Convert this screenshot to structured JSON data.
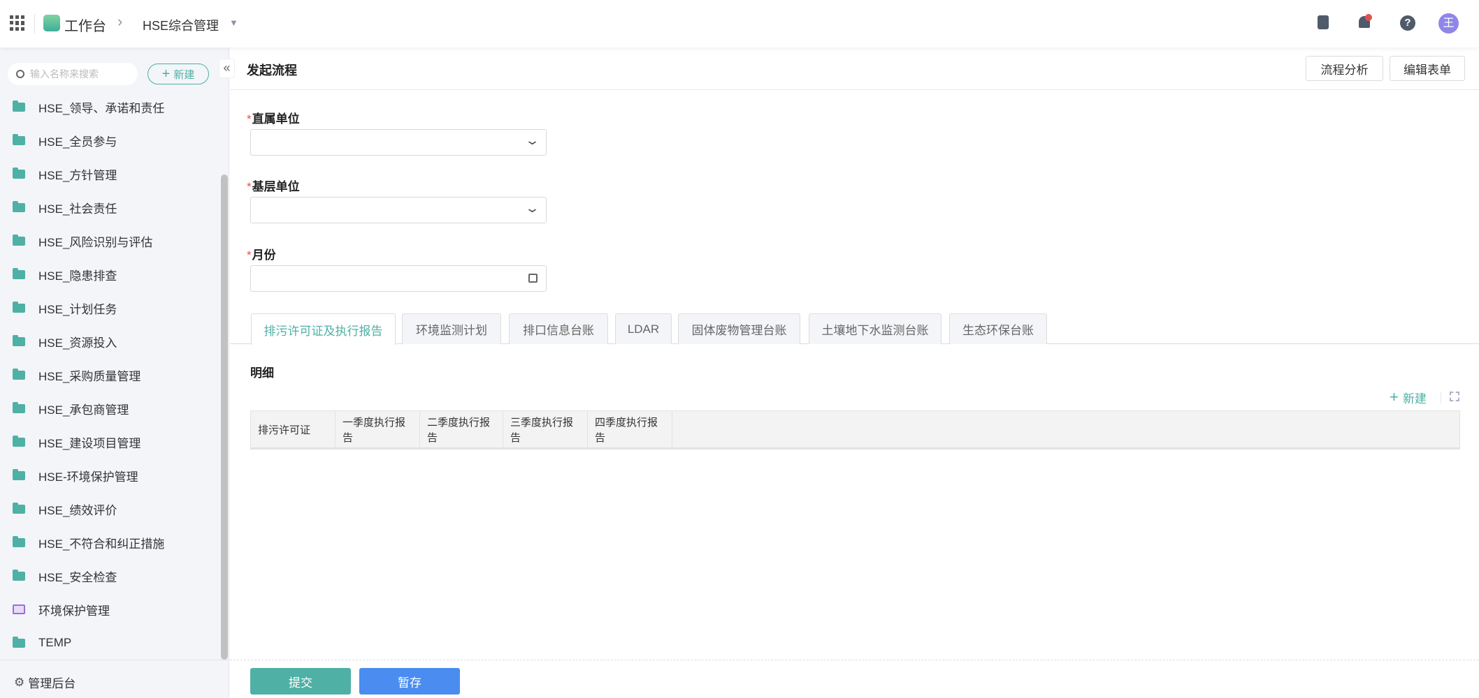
{
  "topbar": {
    "app": "工作台",
    "module": "HSE综合管理",
    "avatar": "王"
  },
  "sidebar": {
    "search_placeholder": "输入名称来搜索",
    "new_label": "新建",
    "items": [
      {
        "label": "HSE_领导、承诺和责任",
        "icon": "folder"
      },
      {
        "label": "HSE_全员参与",
        "icon": "folder"
      },
      {
        "label": "HSE_方针管理",
        "icon": "folder"
      },
      {
        "label": "HSE_社会责任",
        "icon": "folder"
      },
      {
        "label": "HSE_风险识别与评估",
        "icon": "folder"
      },
      {
        "label": "HSE_隐患排查",
        "icon": "folder"
      },
      {
        "label": "HSE_计划任务",
        "icon": "folder"
      },
      {
        "label": "HSE_资源投入",
        "icon": "folder"
      },
      {
        "label": "HSE_采购质量管理",
        "icon": "folder"
      },
      {
        "label": "HSE_承包商管理",
        "icon": "folder"
      },
      {
        "label": "HSE_建设项目管理",
        "icon": "folder"
      },
      {
        "label": "HSE-环境保护管理",
        "icon": "folder"
      },
      {
        "label": "HSE_绩效评价",
        "icon": "folder"
      },
      {
        "label": "HSE_不符合和纠正措施",
        "icon": "folder"
      },
      {
        "label": "HSE_安全检查",
        "icon": "folder"
      },
      {
        "label": "环境保护管理",
        "icon": "monitor"
      },
      {
        "label": "TEMP",
        "icon": "folder"
      }
    ],
    "admin": "管理后台"
  },
  "main": {
    "title": "发起流程",
    "flow_analysis": "流程分析",
    "edit_form": "编辑表单",
    "fields": [
      {
        "label": "直属单位",
        "required": "*",
        "value": ""
      },
      {
        "label": "基层单位",
        "required": "*",
        "value": ""
      },
      {
        "label": "月份",
        "required": "*",
        "value": ""
      }
    ],
    "tabs": [
      "排污许可证及执行报告",
      "环境监测计划",
      "排口信息台账",
      "LDAR",
      "固体废物管理台账",
      "土壤地下水监测台账",
      "生态环保台账"
    ],
    "detail_title": "明细",
    "detail_new": "新建",
    "columns": [
      "排污许可证",
      "一季度执行报告",
      "二季度执行报告",
      "三季度执行报告",
      "四季度执行报告"
    ],
    "submit": "提交",
    "save": "暂存"
  },
  "colors": {
    "accent": "#4fb0a5",
    "primary": "#4a8cf0",
    "required": "#e0524c",
    "avatar": "#8f86e8"
  }
}
